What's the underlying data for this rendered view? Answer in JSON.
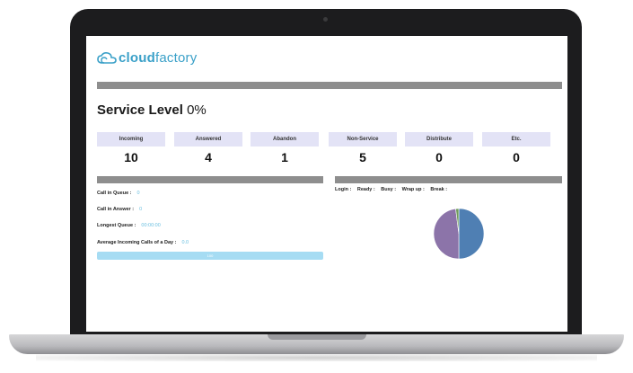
{
  "brand": {
    "name_bold": "cloud",
    "name_light": "factory",
    "accent": "#3aa0c8"
  },
  "header_bar": {
    "caption": ""
  },
  "service_level": {
    "label": "Service Level",
    "value": "0%"
  },
  "stats": [
    {
      "label": "Incoming",
      "value": "10"
    },
    {
      "label": "Answered",
      "value": "4"
    },
    {
      "label": "Abandon",
      "value": "1"
    },
    {
      "label": "Non-Service",
      "value": "5"
    },
    {
      "label": "Distribute",
      "value": "0"
    },
    {
      "label": "Etc.",
      "value": "0"
    }
  ],
  "left_panel": {
    "caption": "",
    "call_in_queue": {
      "label": "Call in Queue :",
      "value": "0"
    },
    "call_in_answer": {
      "label": "Call in Answer :",
      "value": "0"
    },
    "longest_queue": {
      "label": "Longest Queue :",
      "value": "00:00:00"
    },
    "avg_incoming": {
      "label": "Average Incoming Calls of a Day :",
      "value": "0.0"
    },
    "progress": {
      "percent": 100,
      "text": "100"
    }
  },
  "right_panel": {
    "caption": "",
    "statuses": [
      "Login :",
      "Ready :",
      "Busy :",
      "Wrap up :",
      "Break :"
    ]
  },
  "chart_data": {
    "type": "pie",
    "slices": [
      {
        "label": "",
        "value": 50,
        "color": "#4f7fb3"
      },
      {
        "label": "",
        "value": 48,
        "color": "#8c74a9"
      },
      {
        "label": "",
        "value": 2,
        "color": "#6f9c5b"
      }
    ]
  },
  "colors": {
    "stat_label_bg": "#e3e3f6",
    "section_bar": "#8e8e8e",
    "progress": "#a6dcf3"
  }
}
